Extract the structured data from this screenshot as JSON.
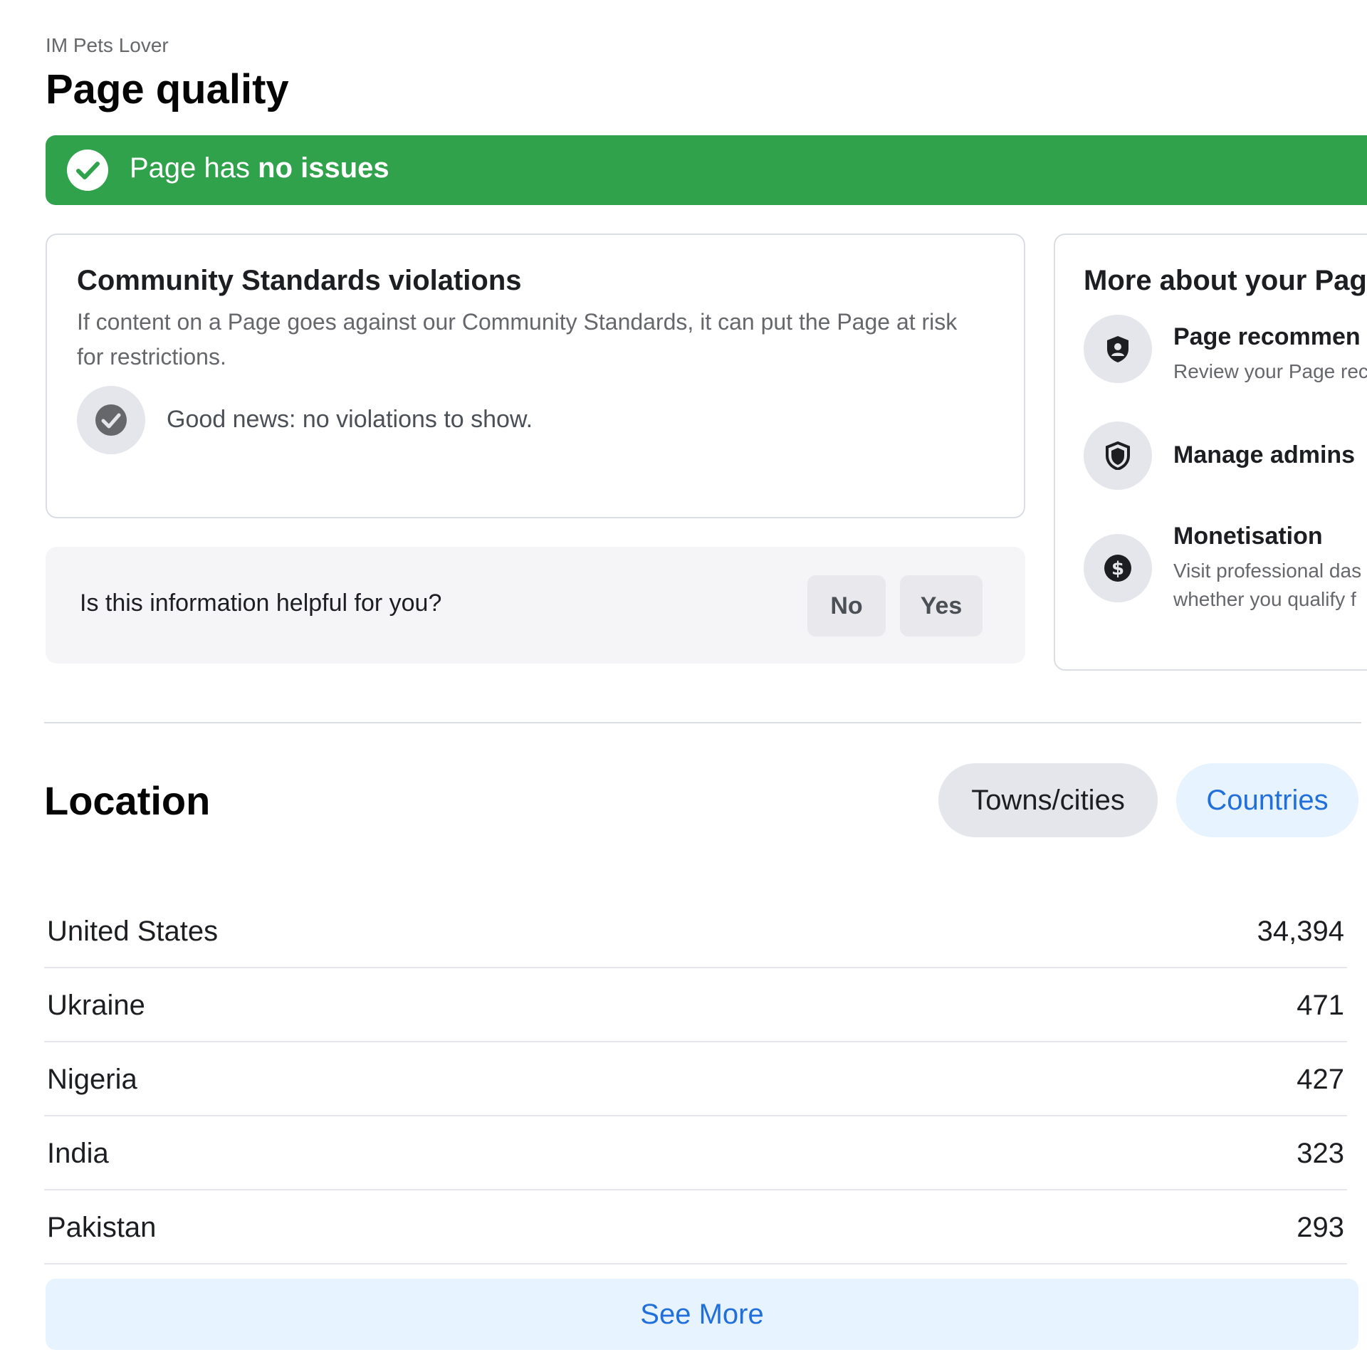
{
  "header": {
    "breadcrumb": "IM Pets Lover",
    "title": "Page quality"
  },
  "status_banner": {
    "text_prefix": "Page has ",
    "text_bold": "no issues",
    "color": "#31a24c",
    "icon": "check-circle-icon"
  },
  "community_standards": {
    "title": "Community Standards violations",
    "description": "If content on a Page goes against our Community Standards, it can put the Page at risk for restrictions.",
    "status_text": "Good news: no violations to show.",
    "status_icon": "check-circle-icon"
  },
  "feedback": {
    "question": "Is this information helpful for you?",
    "no_label": "No",
    "yes_label": "Yes"
  },
  "more_about": {
    "title": "More about your Pag",
    "items": [
      {
        "title": "Page recommen",
        "subtitle": "Review your Page rec",
        "icon": "shield-person-icon"
      },
      {
        "title": "Manage admins",
        "subtitle": "",
        "icon": "shield-icon"
      },
      {
        "title": "Monetisation",
        "subtitle": "Visit professional das",
        "subtitle2": "whether you qualify f",
        "icon": "dollar-icon"
      }
    ]
  },
  "location": {
    "title": "Location",
    "tabs": [
      {
        "label": "Towns/cities",
        "selected": false
      },
      {
        "label": "Countries",
        "selected": true
      }
    ],
    "rows": [
      {
        "name": "United States",
        "count": "34,394"
      },
      {
        "name": "Ukraine",
        "count": "471"
      },
      {
        "name": "Nigeria",
        "count": "427"
      },
      {
        "name": "India",
        "count": "323"
      },
      {
        "name": "Pakistan",
        "count": "293"
      }
    ],
    "see_more_label": "See More"
  },
  "colors": {
    "accent_blue": "#216fdb",
    "success_green": "#31a24c"
  }
}
